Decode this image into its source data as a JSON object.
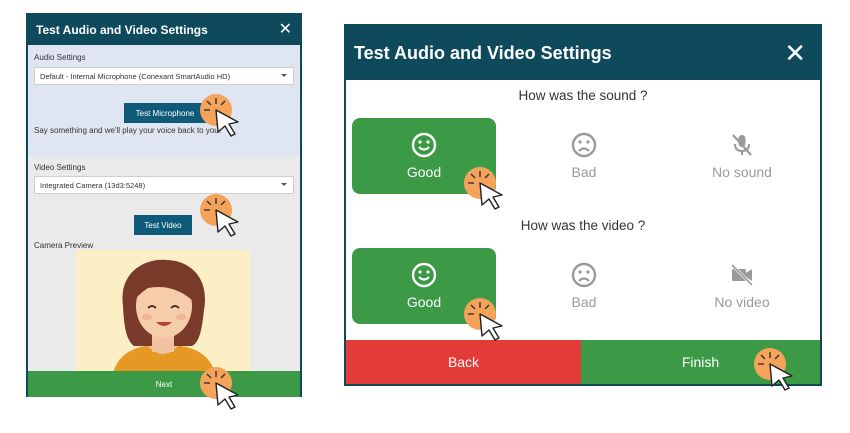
{
  "left_dialog": {
    "title": "Test Audio and Video Settings",
    "close_glyph": "✕",
    "audio": {
      "label": "Audio Settings",
      "selected_device": "Default - Internal Microphone (Conexant SmartAudio HD)",
      "test_button": "Test Microphone",
      "hint": "Say something and we'll play your voice back to you."
    },
    "video": {
      "label": "Video Settings",
      "selected_device": "Integrated Camera (13d3:5248)",
      "test_button": "Test Video",
      "preview_label": "Camera Preview"
    },
    "next_button": "Next"
  },
  "right_dialog": {
    "title": "Test Audio and Video Settings",
    "close_glyph": "✕",
    "sound_question": "How was the sound ?",
    "sound_options": [
      {
        "label": "Good",
        "icon": "smile-icon",
        "selected": true
      },
      {
        "label": "Bad",
        "icon": "frown-icon",
        "selected": false
      },
      {
        "label": "No sound",
        "icon": "mic-off-icon",
        "selected": false
      }
    ],
    "video_question": "How was the video ?",
    "video_options": [
      {
        "label": "Good",
        "icon": "smile-icon",
        "selected": true
      },
      {
        "label": "Bad",
        "icon": "frown-icon",
        "selected": false
      },
      {
        "label": "No video",
        "icon": "video-off-icon",
        "selected": false
      }
    ],
    "back_button": "Back",
    "finish_button": "Finish"
  },
  "colors": {
    "title_bar": "#0e4a5c",
    "primary_button": "#0e5a78",
    "success": "#3c9a47",
    "danger": "#e23b38",
    "click_marker": "#f5a25a"
  }
}
